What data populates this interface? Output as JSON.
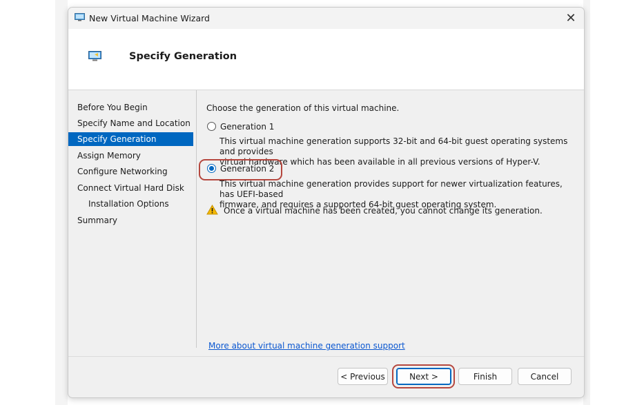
{
  "window": {
    "title": "New Virtual Machine Wizard",
    "close_glyph": "✕"
  },
  "header": {
    "title": "Specify Generation"
  },
  "nav": {
    "items": [
      {
        "label": "Before You Begin"
      },
      {
        "label": "Specify Name and Location"
      },
      {
        "label": "Specify Generation"
      },
      {
        "label": "Assign Memory"
      },
      {
        "label": "Configure Networking"
      },
      {
        "label": "Connect Virtual Hard Disk"
      },
      {
        "label": "Installation Options"
      },
      {
        "label": "Summary"
      }
    ],
    "active": "Specify Generation"
  },
  "content": {
    "prompt": "Choose the generation of this virtual machine.",
    "options": [
      {
        "label": "Generation 1",
        "selected": false,
        "description_line1": "This virtual machine generation supports 32-bit and 64-bit guest operating systems and provides",
        "description_line2": "virtual hardware which has been available in all previous versions of Hyper-V."
      },
      {
        "label": "Generation 2",
        "selected": true,
        "description_line1": "This virtual machine generation provides support for newer virtualization features, has UEFI-based",
        "description_line2": "firmware, and requires a supported 64-bit guest operating system."
      }
    ],
    "warning": "Once a virtual machine has been created, you cannot change its generation.",
    "help_link": "More about virtual machine generation support"
  },
  "buttons": {
    "previous": "< Previous",
    "next": "Next >",
    "finish": "Finish",
    "cancel": "Cancel"
  },
  "colors": {
    "accent": "#0067c0",
    "highlight_annotation": "#b5473e",
    "warning": "#f5b800"
  },
  "icons": {
    "window_icon": "vm-monitor-icon",
    "header_icon": "vm-monitor-icon",
    "warning_icon": "warning-triangle-icon",
    "close_icon": "close-icon"
  }
}
